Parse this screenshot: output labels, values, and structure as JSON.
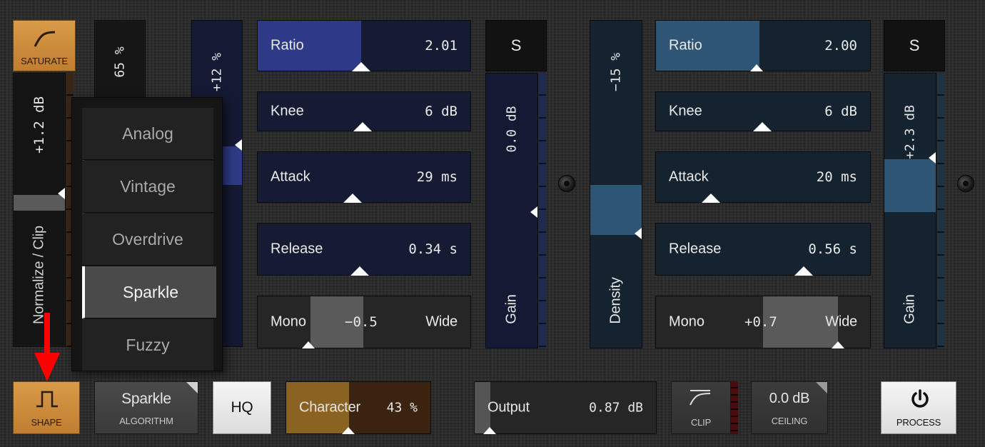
{
  "saturate": {
    "button_label": "SATURATE",
    "icon": "saturate-curve-icon",
    "gain_value": "+1.2 dB",
    "mode_label": "Normalize / Clip"
  },
  "drive_strip": {
    "value": "65 %"
  },
  "left_strip": {
    "value": "+12 %"
  },
  "algorithm_menu": {
    "items": [
      "Analog",
      "Vintage",
      "Overdrive",
      "Sparkle",
      "Fuzzy"
    ],
    "selected": "Sparkle"
  },
  "comp_left": {
    "ratio": {
      "label": "Ratio",
      "value": "2.01"
    },
    "knee": {
      "label": "Knee",
      "value": "6 dB"
    },
    "attack": {
      "label": "Attack",
      "value": "29 ms"
    },
    "release": {
      "label": "Release",
      "value": "0.34 s"
    },
    "width": {
      "left_label": "Mono",
      "value": "−0.5",
      "right_label": "Wide"
    },
    "solo_label": "S",
    "gain_value": "0.0 dB",
    "gain_label": "Gain"
  },
  "comp_right": {
    "density_value": "−15 %",
    "density_label": "Density",
    "ratio": {
      "label": "Ratio",
      "value": "2.00"
    },
    "knee": {
      "label": "Knee",
      "value": "6 dB"
    },
    "attack": {
      "label": "Attack",
      "value": "20 ms"
    },
    "release": {
      "label": "Release",
      "value": "0.56 s"
    },
    "width": {
      "left_label": "Mono",
      "value": "+0.7",
      "right_label": "Wide"
    },
    "solo_label": "S",
    "gain_value": "+2.3 dB",
    "gain_label": "Gain"
  },
  "bottom": {
    "shape_label": "SHAPE",
    "shape_icon": "square-wave-icon",
    "algorithm_value": "Sparkle",
    "algorithm_label": "ALGORITHM",
    "hq_label": "HQ",
    "character": {
      "label": "Character",
      "value": "43 %",
      "level": 0.43
    },
    "output": {
      "label": "Output",
      "value": "0.87 dB"
    },
    "clip_label": "CLIP",
    "clip_icon": "clip-curve-icon",
    "ceiling_value": "0.0 dB",
    "ceiling_label": "CEILING",
    "process_label": "PROCESS",
    "process_icon": "power-icon"
  },
  "colors": {
    "orange": "#d4923f",
    "blue_left": "#2f3a86",
    "blue_right": "#2f5574",
    "arrow": "#ff0000"
  }
}
